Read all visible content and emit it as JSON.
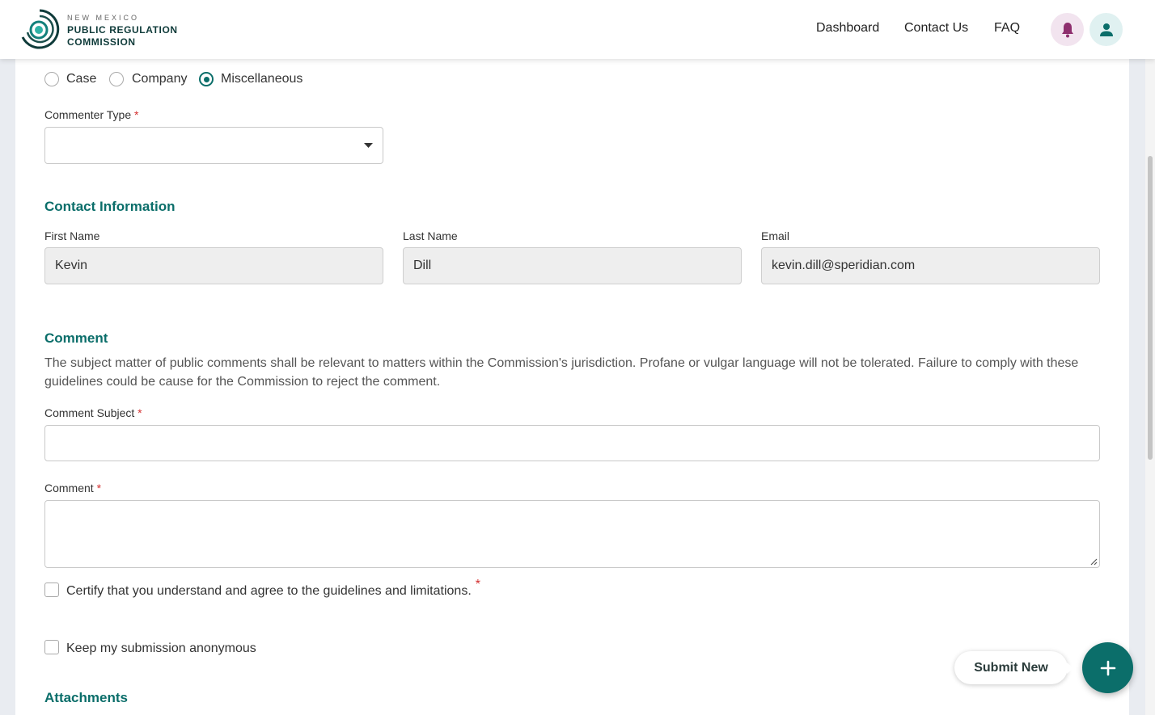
{
  "header": {
    "logo_small": "NEW MEXICO",
    "logo_line1": "PUBLIC REGULATION",
    "logo_line2": "COMMISSION",
    "nav": [
      "Dashboard",
      "Contact Us",
      "FAQ"
    ]
  },
  "category": {
    "options": [
      "Case",
      "Company",
      "Miscellaneous"
    ],
    "selected": "Miscellaneous"
  },
  "commenter_type": {
    "label": "Commenter Type",
    "value": ""
  },
  "contact": {
    "heading": "Contact Information",
    "first_name_label": "First Name",
    "first_name": "Kevin",
    "last_name_label": "Last Name",
    "last_name": "Dill",
    "email_label": "Email",
    "email": "kevin.dill@speridian.com"
  },
  "comment": {
    "heading": "Comment",
    "description": "The subject matter of public comments shall be relevant to matters within the Commission's jurisdiction. Profane or vulgar language will not be tolerated. Failure to comply with these guidelines could be cause for the Commission to reject the comment.",
    "subject_label": "Comment Subject",
    "comment_label": "Comment",
    "certify_label": "Certify that you understand and agree to the guidelines and limitations.",
    "anonymous_label": "Keep my submission anonymous"
  },
  "attachments": {
    "heading": "Attachments"
  },
  "actions": {
    "submit_new": "Submit New"
  },
  "colors": {
    "accent": "#0b6e6a",
    "required": "#d32f2f",
    "bell_bg": "#f2e4ef",
    "user_bg": "#e0f1f1"
  }
}
